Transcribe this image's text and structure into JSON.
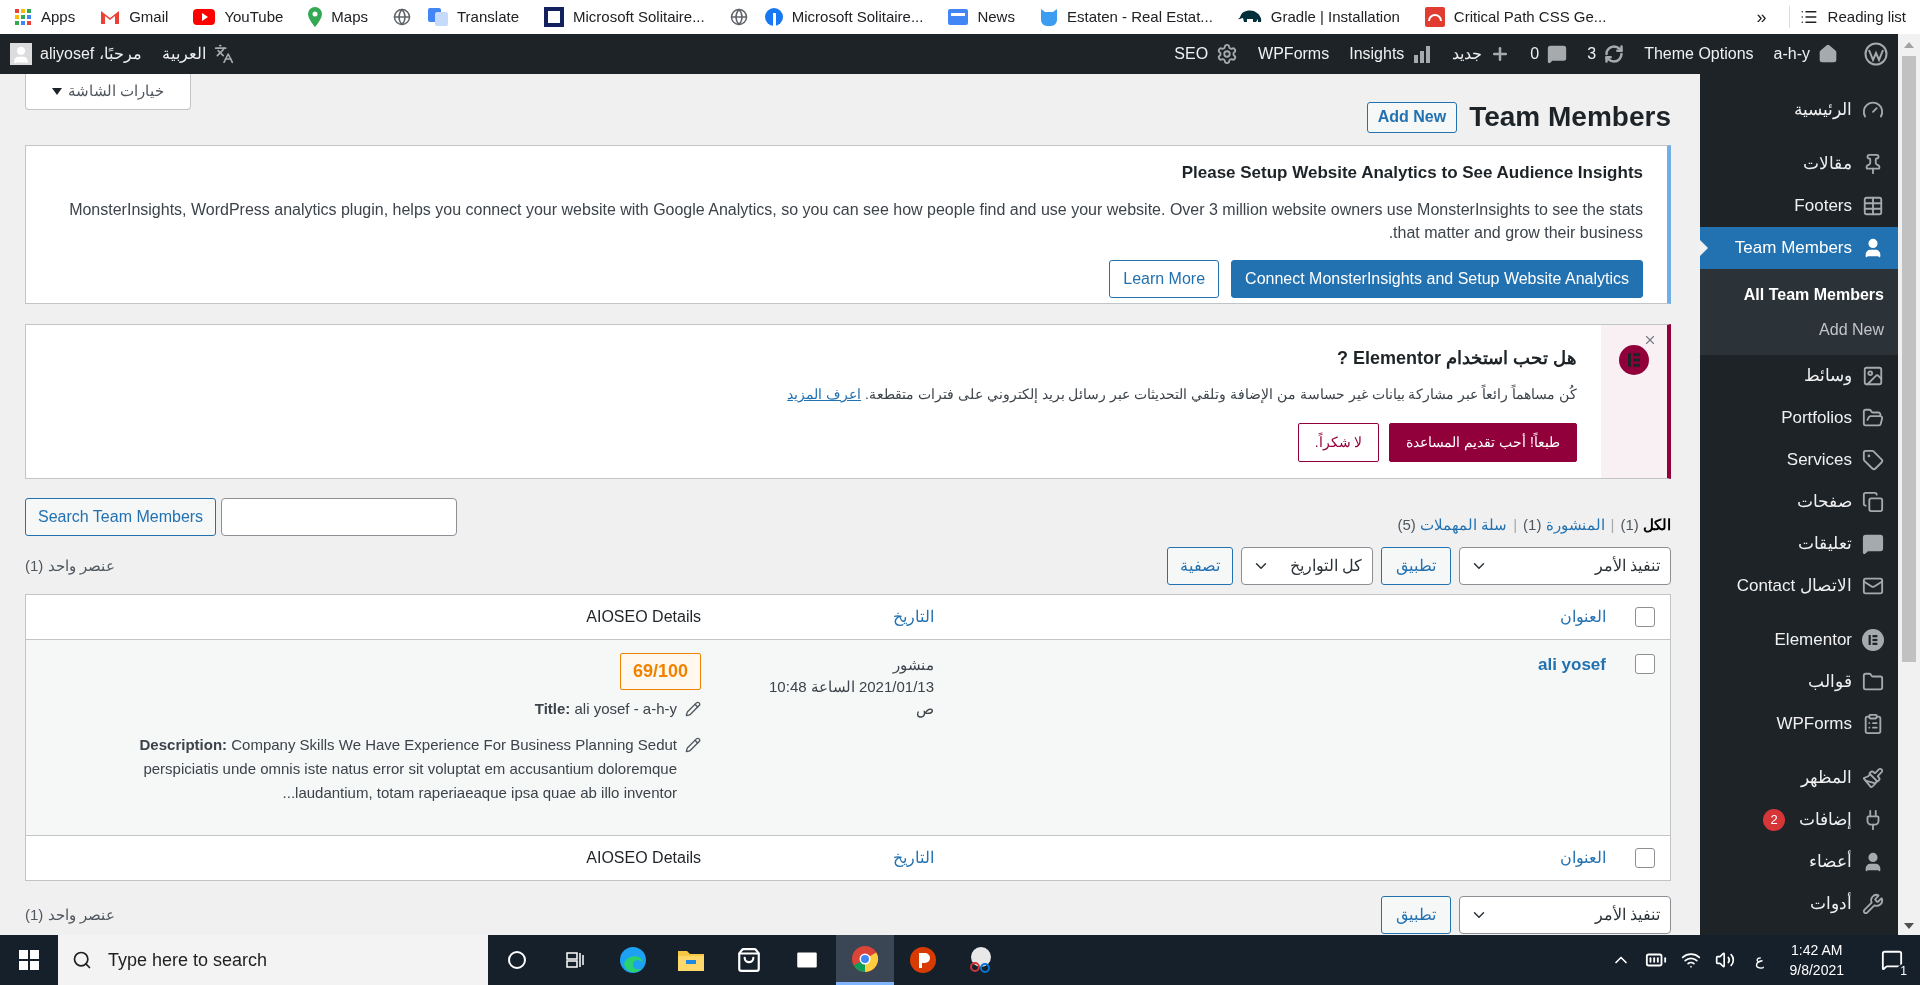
{
  "browser": {
    "bookmarks": [
      {
        "label": "Critical Path CSS Ge..."
      },
      {
        "label": "Gradle | Installation"
      },
      {
        "label": "Estaten - Real Estat..."
      },
      {
        "label": "News"
      },
      {
        "label": "Microsoft Solitaire..."
      },
      {
        "label": "Microsoft Solitaire..."
      },
      {
        "label": "Translate"
      },
      {
        "label": "Maps"
      },
      {
        "label": "YouTube"
      },
      {
        "label": "Gmail"
      },
      {
        "label": "Apps"
      }
    ],
    "more": "»",
    "reading_list": "Reading list"
  },
  "admin_bar": {
    "greeting": "مرحبًا، aliyosef",
    "language": "العربية",
    "items": [
      {
        "label": "a-h-y"
      },
      {
        "label": "Theme Options"
      },
      {
        "label": "3"
      },
      {
        "label": "0"
      },
      {
        "label": "جديد"
      },
      {
        "label": "Insights"
      },
      {
        "label": "WPForms"
      },
      {
        "label": "SEO"
      }
    ]
  },
  "screen_options": "خيارات الشاشة",
  "page": {
    "title": "Team Members",
    "add_new": "Add New"
  },
  "analytics_notice": {
    "title": "Please Setup Website Analytics to See Audience Insights",
    "lines": [
      "MonsterInsights, WordPress analytics plugin, helps you connect your website with Google Analytics, so you can see how people find and use your website. Over 3 million website owners use MonsterInsights to see the stats",
      ".that matter and grow their business"
    ],
    "buttons": [
      {
        "label": "Connect MonsterInsights and Setup Website Analytics",
        "kind": "primary"
      },
      {
        "label": "Learn More",
        "kind": "secondary"
      }
    ]
  },
  "elementor_notice": {
    "title": "هل تحب استخدام Elementor ?",
    "text": "كُن مساهماً رائعاً عبر مشاركة بيانات غير حساسة من الإضافة وتلقي التحديثات عبر رسائل بريد إلكتروني على فترات متقطعة.",
    "link": "اعرف المزيد",
    "buttons": [
      {
        "label": "طبعاً! أحب تقديم المساعدة",
        "kind": "primary"
      },
      {
        "label": "لا شكراً.",
        "kind": "secondary"
      }
    ]
  },
  "search": {
    "button": "Search Team Members"
  },
  "filters": [
    {
      "label": "الكل",
      "count": "(1)",
      "separator": "|",
      "selected": true
    },
    {
      "label": "المنشورة",
      "count": "(1)",
      "separator": "|",
      "selected": false
    },
    {
      "label": "سلة المهملات",
      "count": "(5)",
      "selected": false
    }
  ],
  "tablenav_top": {
    "bulk_action": "تنفيذ الأمر",
    "apply": "تطبيق",
    "date_filter": "كل التواريخ",
    "filter": "تصفية",
    "count": "عنصر واحد (1)"
  },
  "table": {
    "columns": [
      "العنوان",
      "التاريخ",
      "AIOSEO Details"
    ],
    "header_checked": false,
    "rows": [
      {
        "checked": false,
        "title": "ali yosef",
        "date_lines": [
          "منشور",
          "2021/01/13 الساعة 10:48",
          "ص"
        ],
        "score": "69/100",
        "seo_title": "**Title:** ali yosef - a-h-y",
        "description_lines": [
          "**Description:** Company Skills We Have Experience For Business Planning Sedut",
          "perspiciatis unde omnis iste natus error sit voluptat em accusantium doloremque",
          "...laudantium, totam raperiaeaque ipsa quae ab illo inventor"
        ]
      }
    ],
    "footer_columns": [
      "العنوان",
      "التاريخ",
      "AIOSEO Details"
    ],
    "footer_checked": false
  },
  "tablenav_bottom": {
    "bulk_action": "تنفيذ الأمر",
    "apply": "تطبيق",
    "count": "عنصر واحد (1)"
  },
  "admin_menu": {
    "groups": [
      {
        "items": [
          {
            "label": "الرئيسية",
            "selected": false
          }
        ]
      },
      {
        "items": [
          {
            "label": "مقالات",
            "selected": false
          },
          {
            "label": "Footers",
            "selected": false
          },
          {
            "label": "Team Members",
            "selected": true,
            "submenu": [
              {
                "label": "All Team Members",
                "selected": true
              },
              {
                "label": "Add New",
                "selected": false
              }
            ]
          },
          {
            "label": "وسائط",
            "selected": false
          },
          {
            "label": "Portfolios",
            "selected": false
          },
          {
            "label": "Services",
            "selected": false
          },
          {
            "label": "صفحات",
            "selected": false
          },
          {
            "label": "تعليقات",
            "selected": false
          },
          {
            "label": "الاتصال Contact",
            "selected": false
          }
        ]
      },
      {
        "items": [
          {
            "label": "Elementor",
            "selected": false
          },
          {
            "label": "قوالب",
            "selected": false
          },
          {
            "label": "WPForms",
            "selected": false
          }
        ]
      },
      {
        "items": [
          {
            "label": "المظهر",
            "selected": false
          },
          {
            "label": "إضافات",
            "badge": "2",
            "selected": false
          },
          {
            "label": "أعضاء",
            "selected": false
          },
          {
            "label": "أدوات",
            "selected": false
          }
        ]
      }
    ]
  },
  "taskbar": {
    "search_placeholder": "Type here to search",
    "language": "ع",
    "time": "1:42 AM",
    "date": "9/8/2021",
    "notifications": "1"
  }
}
